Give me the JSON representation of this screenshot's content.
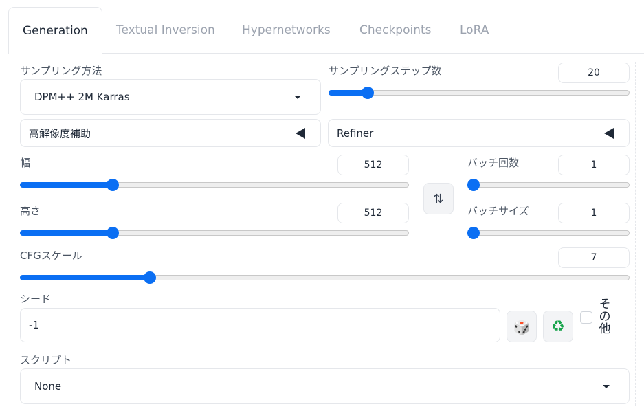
{
  "tabs": [
    {
      "label": "Generation",
      "active": true
    },
    {
      "label": "Textual Inversion",
      "active": false
    },
    {
      "label": "Hypernetworks",
      "active": false
    },
    {
      "label": "Checkpoints",
      "active": false
    },
    {
      "label": "LoRA",
      "active": false
    }
  ],
  "sampling": {
    "method_label": "サンプリング方法",
    "method_value": "DPM++ 2M Karras",
    "steps_label": "サンプリングステップ数",
    "steps_value": "20",
    "steps_fraction": 0.13
  },
  "hires": {
    "label": "高解像度補助"
  },
  "refiner": {
    "label": "Refiner"
  },
  "width": {
    "label": "幅",
    "value": "512",
    "fraction": 0.238
  },
  "height": {
    "label": "高さ",
    "value": "512",
    "fraction": 0.238
  },
  "batch_count": {
    "label": "バッチ回数",
    "value": "1",
    "fraction": 0.0
  },
  "batch_size": {
    "label": "バッチサイズ",
    "value": "1",
    "fraction": 0.0
  },
  "cfg": {
    "label": "CFGスケール",
    "value": "7",
    "fraction": 0.213
  },
  "seed": {
    "label": "シード",
    "value": "-1",
    "extra_label_1": "そ",
    "extra_label_2": "の",
    "extra_label_3": "他"
  },
  "script": {
    "label": "スクリプト",
    "value": "None"
  },
  "icons": {
    "swap": "⇅",
    "dice": "🎲",
    "recycle": "♻"
  },
  "colors": {
    "accent": "#0b6ff3",
    "recycle": "#16a34a"
  }
}
